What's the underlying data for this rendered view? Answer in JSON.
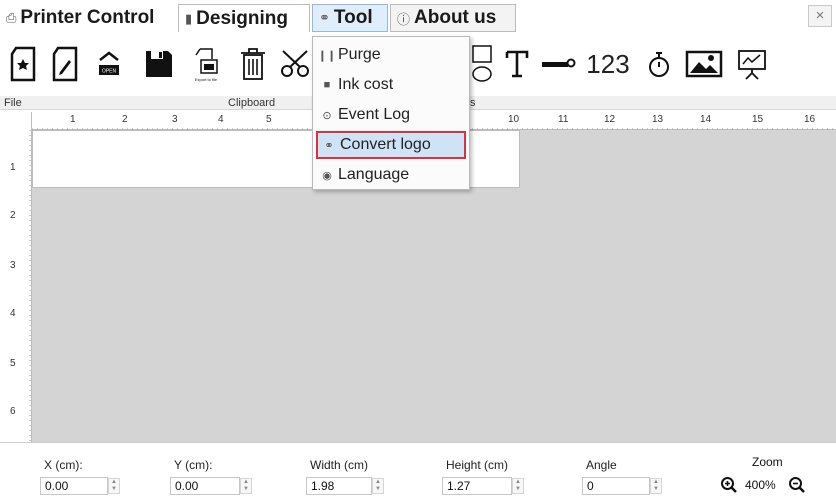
{
  "tabs": {
    "printer": "Printer Control",
    "designing": "Designing",
    "tool": "Tool",
    "about": "About us",
    "close": "×"
  },
  "toolbar": {
    "export_label": "Export to file",
    "open_label": "OPEN",
    "counter_label": "123"
  },
  "groups": {
    "file": "File",
    "clipboard": "Clipboard",
    "objects_tail": "s"
  },
  "ruler": {
    "h": [
      "1",
      "2",
      "3",
      "4",
      "5",
      "10",
      "11",
      "12",
      "13",
      "14",
      "15",
      "16"
    ],
    "v": [
      "1",
      "2",
      "3",
      "4",
      "5",
      "6"
    ]
  },
  "menu": {
    "items": [
      {
        "label": "Purge",
        "icon": "purge-icon"
      },
      {
        "label": "Ink cost",
        "icon": "ink-cost-icon"
      },
      {
        "label": "Event Log",
        "icon": "event-log-icon"
      },
      {
        "label": "Convert logo",
        "icon": "convert-logo-icon"
      },
      {
        "label": "Language",
        "icon": "globe-icon"
      }
    ],
    "active_index": 3
  },
  "status": {
    "x_label": "X (cm):",
    "x_value": "0.00",
    "y_label": "Y (cm):",
    "y_value": "0.00",
    "width_label": "Width (cm)",
    "width_value": "1.98",
    "height_label": "Height (cm)",
    "height_value": "1.27",
    "angle_label": "Angle",
    "angle_value": "0",
    "zoom_label": "Zoom",
    "zoom_value": "400%"
  },
  "colors": {
    "menu_highlight": "#cfe3f7",
    "menu_highlight_border": "#d9343e",
    "canvas_bg": "#d4d4d4",
    "tab_active_bg": "#e0eefb"
  }
}
